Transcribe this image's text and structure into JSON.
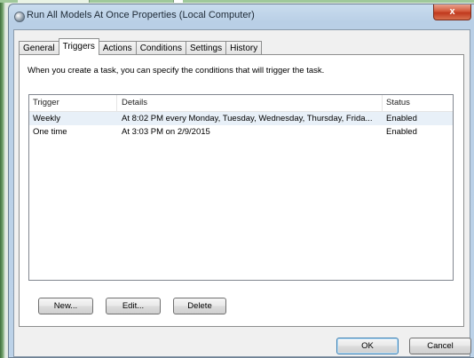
{
  "window": {
    "title": "Run All Models At Once Properties (Local Computer)",
    "close_label": "x"
  },
  "tabs": [
    {
      "label": "General",
      "active": false
    },
    {
      "label": "Triggers",
      "active": true
    },
    {
      "label": "Actions",
      "active": false
    },
    {
      "label": "Conditions",
      "active": false
    },
    {
      "label": "Settings",
      "active": false
    },
    {
      "label": "History",
      "active": false
    }
  ],
  "triggers_panel": {
    "description": "When you create a task, you can specify the conditions that will trigger the task.",
    "columns": {
      "trigger": "Trigger",
      "details": "Details",
      "status": "Status"
    },
    "rows": [
      {
        "trigger": "Weekly",
        "details": "At 8:02 PM every Monday, Tuesday, Wednesday, Thursday, Frida...",
        "status": "Enabled"
      },
      {
        "trigger": "One time",
        "details": "At 3:03 PM on 2/9/2015",
        "status": "Enabled"
      }
    ],
    "buttons": {
      "new": "New...",
      "edit": "Edit...",
      "delete": "Delete"
    }
  },
  "dialog_buttons": {
    "ok": "OK",
    "cancel": "Cancel"
  }
}
